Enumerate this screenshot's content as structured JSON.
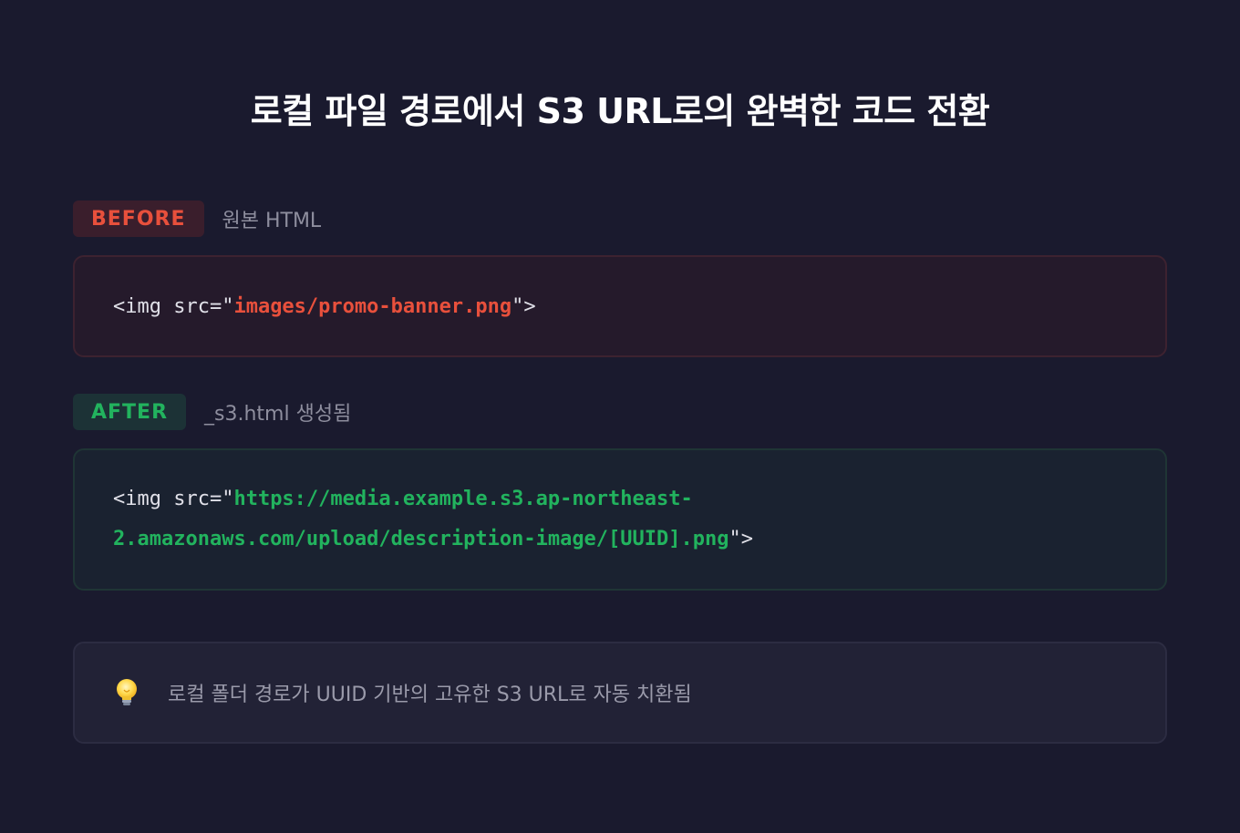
{
  "title": "로컬 파일 경로에서 S3 URL로의 완벽한 코드 전환",
  "before": {
    "badge": "BEFORE",
    "description": "원본 HTML",
    "code_prefix": "<img src=\"",
    "code_value": "images/promo-banner.png",
    "code_suffix": "\">"
  },
  "after": {
    "badge": "AFTER",
    "description": "_s3.html 생성됨",
    "code_prefix": "<img src=\"",
    "code_value_line1": "https://media.example.s3.ap-northeast-",
    "code_value_line2": "2.amazonaws.com/upload/description-image/[UUID].png",
    "code_suffix": "\">"
  },
  "note": {
    "icon": "lightbulb-icon",
    "text": "로컬 폴더 경로가 UUID 기반의 고유한 S3 URL로 자동 치환됨"
  },
  "colors": {
    "background": "#1a1a2e",
    "before_accent": "#e8503c",
    "after_accent": "#22b35e"
  }
}
